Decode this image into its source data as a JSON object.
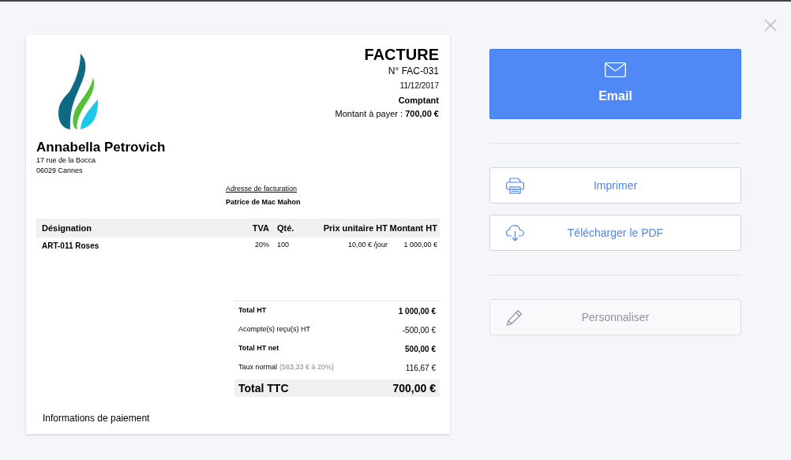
{
  "invoice": {
    "title": "FACTURE",
    "number": "N° FAC-031",
    "date": "11/12/2017",
    "payment_terms": "Comptant",
    "amount_due": "Montant à payer : **700,00 €**",
    "client": {
      "name": "Annabella Petrovich",
      "address": [
        "17 rue de la Bocca",
        "06029 Cannes"
      ]
    },
    "billing": {
      "label": "Adresse de facturation",
      "name": "Patrice de Mac Mahon"
    },
    "table": {
      "columns": [
        "Désignation",
        "TVA",
        "Qté.",
        "Prix unitaire HT",
        "Montant HT"
      ],
      "rows": [
        [
          "ART-011 Roses",
          "20%",
          "100",
          "10,00 € /jour",
          "1 000,00 €"
        ]
      ]
    },
    "totals": [
      {
        "kind": "bold",
        "label": "Total HT",
        "value": "1 000,00 €"
      },
      {
        "kind": "plain",
        "label": "Acompte(s) reçu(s) HT",
        "value": "-500,00 €"
      },
      {
        "kind": "bold",
        "label": "Total HT net",
        "value": "500,00 €"
      },
      {
        "kind": "plain",
        "label": "Taux normal",
        "note": "(583,33 € à 20%)",
        "value": "116,67 €"
      },
      {
        "kind": "grand",
        "label": "Total TTC",
        "value": "700,00 €"
      }
    ],
    "payment_heading": "Informations de paiement"
  },
  "actions": [
    {
      "kind": "primary",
      "label": "Email"
    },
    {
      "kind": "default",
      "label": "Imprimer"
    },
    {
      "kind": "default",
      "label": "Télécharger le PDF"
    },
    {
      "kind": "disabled",
      "label": "Personnaliser"
    }
  ]
}
